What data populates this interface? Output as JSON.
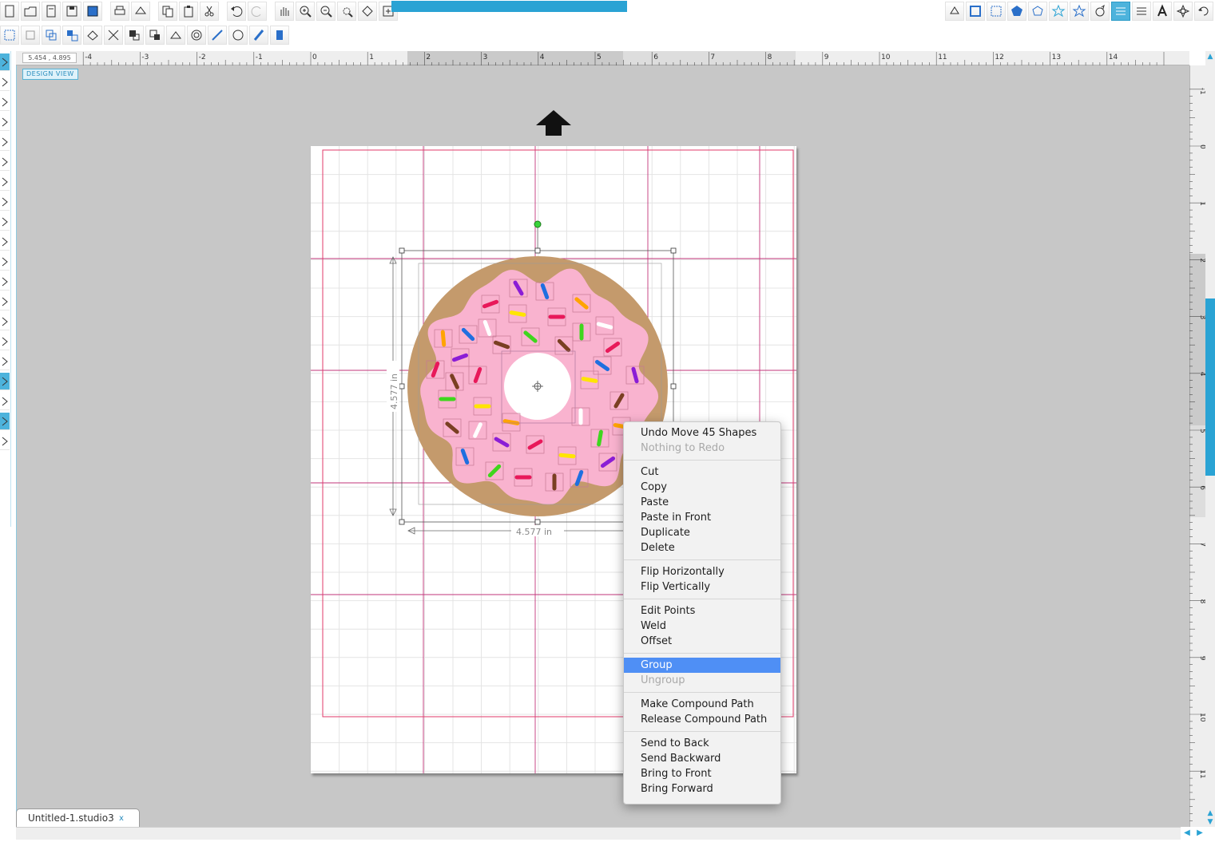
{
  "toolbar_top": {
    "left_icons": [
      "new-document-icon",
      "open-folder-icon",
      "new-file-icon",
      "save-icon",
      "save-to-library-icon",
      "print-icon",
      "send-to-cutter-icon",
      "copy-icon",
      "paste-icon",
      "cut-scissors-icon",
      "undo-icon",
      "redo-icon",
      "pan-hand-icon",
      "zoom-in-icon",
      "zoom-out-icon",
      "zoom-box-icon",
      "zoom-fit-icon",
      "fit-page-icon"
    ],
    "right_icons": [
      "fill-color-icon",
      "line-color-icon",
      "fill-pattern-icon",
      "polygon-shape-icon",
      "offset-icon",
      "star-icon",
      "star-outline-icon",
      "replicate-icon",
      "align-text-icon",
      "text-style-icon",
      "font-a-icon",
      "transform-icon",
      "rotate-icon"
    ]
  },
  "toolbar_second": {
    "icons": [
      "select-all-icon",
      "deselect-icon",
      "group-icon",
      "ungroup-icon",
      "compound-path-icon",
      "release-compound-icon",
      "weld-icon",
      "subtract-icon",
      "bring-to-front-icon",
      "send-to-back-icon",
      "mirror-icon",
      "offset-ring-icon",
      "knife-icon",
      "trace-icon"
    ]
  },
  "ruler": {
    "coordinate_readout": "5.454 , 4.895",
    "top_labels": [
      "-4",
      "-3",
      "-2",
      "-1",
      "0",
      "1",
      "2",
      "3",
      "4",
      "5",
      "6",
      "7",
      "8",
      "9",
      "10",
      "11",
      "12",
      "13",
      "14"
    ],
    "right_labels": [
      "-1",
      "0",
      "1",
      "2",
      "3",
      "4",
      "5",
      "6",
      "7",
      "8",
      "9",
      "10",
      "11"
    ]
  },
  "design_view_label": "DESIGN VIEW",
  "selection": {
    "width_label": "4.577 in",
    "height_label": "4.577 in"
  },
  "document_tab": {
    "title": "Untitled-1.studio3",
    "close_symbol": "x"
  },
  "context_menu": {
    "groups": [
      [
        {
          "label": "Undo Move 45 Shapes",
          "enabled": true
        },
        {
          "label": "Nothing to Redo",
          "enabled": false
        }
      ],
      [
        {
          "label": "Cut",
          "enabled": true
        },
        {
          "label": "Copy",
          "enabled": true
        },
        {
          "label": "Paste",
          "enabled": true
        },
        {
          "label": "Paste in Front",
          "enabled": true
        },
        {
          "label": "Duplicate",
          "enabled": true
        },
        {
          "label": "Delete",
          "enabled": true
        }
      ],
      [
        {
          "label": "Flip Horizontally",
          "enabled": true
        },
        {
          "label": "Flip Vertically",
          "enabled": true
        }
      ],
      [
        {
          "label": "Edit Points",
          "enabled": true
        },
        {
          "label": "Weld",
          "enabled": true
        },
        {
          "label": "Offset",
          "enabled": true
        }
      ],
      [
        {
          "label": "Group",
          "enabled": true,
          "highlighted": true
        },
        {
          "label": "Ungroup",
          "enabled": false
        }
      ],
      [
        {
          "label": "Make Compound Path",
          "enabled": true
        },
        {
          "label": "Release Compound Path",
          "enabled": true
        }
      ],
      [
        {
          "label": "Send to Back",
          "enabled": true
        },
        {
          "label": "Send Backward",
          "enabled": true
        },
        {
          "label": "Bring to Front",
          "enabled": true
        },
        {
          "label": "Bring Forward",
          "enabled": true
        }
      ]
    ]
  },
  "colors": {
    "accent": "#2aa3d4",
    "dough": "#c49a6c",
    "frosting": "#f9b3cf",
    "menu_highlight": "#4f8ff5",
    "cut_border": "#e23a6a"
  },
  "sprinkle_colors": [
    "#e8195a",
    "#8b1dd6",
    "#1f6fe0",
    "#ffa400",
    "#ffe500",
    "#7a3f22",
    "#3fd61d",
    "#ffffff"
  ]
}
